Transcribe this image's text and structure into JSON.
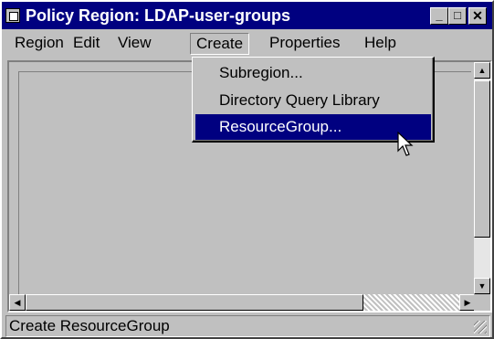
{
  "window": {
    "title": "Policy Region: LDAP-user-groups",
    "controls": {
      "minimize": "_",
      "maximize": "□",
      "close": "✕"
    }
  },
  "menubar": {
    "items": [
      {
        "label": "Region"
      },
      {
        "label": "Edit"
      },
      {
        "label": "View"
      },
      {
        "label": "Create"
      },
      {
        "label": "Properties"
      },
      {
        "label": "Help"
      }
    ],
    "open_menu": "Create"
  },
  "dropdown": {
    "items": [
      {
        "label": "Subregion..."
      },
      {
        "label": "Directory Query Library"
      },
      {
        "label": "ResourceGroup..."
      }
    ],
    "highlighted": "ResourceGroup..."
  },
  "scroll": {
    "up_arrow": "▲",
    "down_arrow": "▼",
    "left_arrow": "◀",
    "right_arrow": "▶"
  },
  "statusbar": {
    "text": "Create ResourceGroup"
  },
  "colors": {
    "titlebar": "#000080",
    "face": "#c0c0c0",
    "highlight": "#000080"
  },
  "icons": {
    "app": "policy-region-icon",
    "cursor": "arrow-pointer-icon"
  }
}
